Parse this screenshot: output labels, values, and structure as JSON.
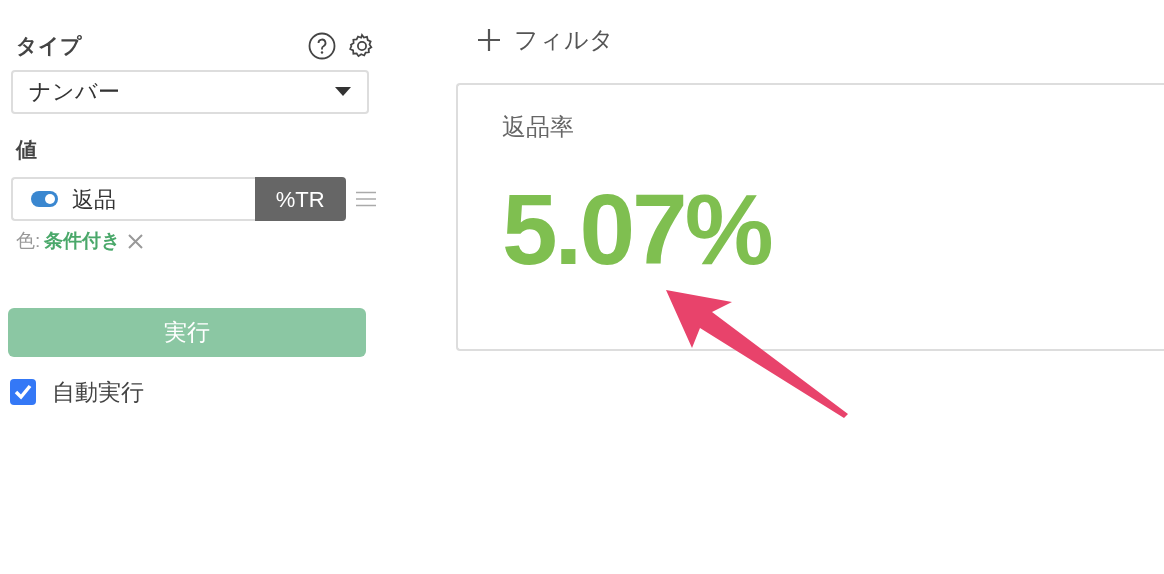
{
  "sidebar": {
    "type_label": "タイプ",
    "type_select": {
      "value": "ナンバー"
    },
    "value_label": "値",
    "value_item": {
      "name": "返品",
      "on": true,
      "calc": "%TR"
    },
    "color_setting": {
      "label": "色:",
      "value": "条件付き"
    },
    "run_button": "実行",
    "auto_run": {
      "label": "自動実行",
      "checked": true
    }
  },
  "filter_button": "フィルタ",
  "card": {
    "title": "返品率",
    "value": "5.07%"
  }
}
